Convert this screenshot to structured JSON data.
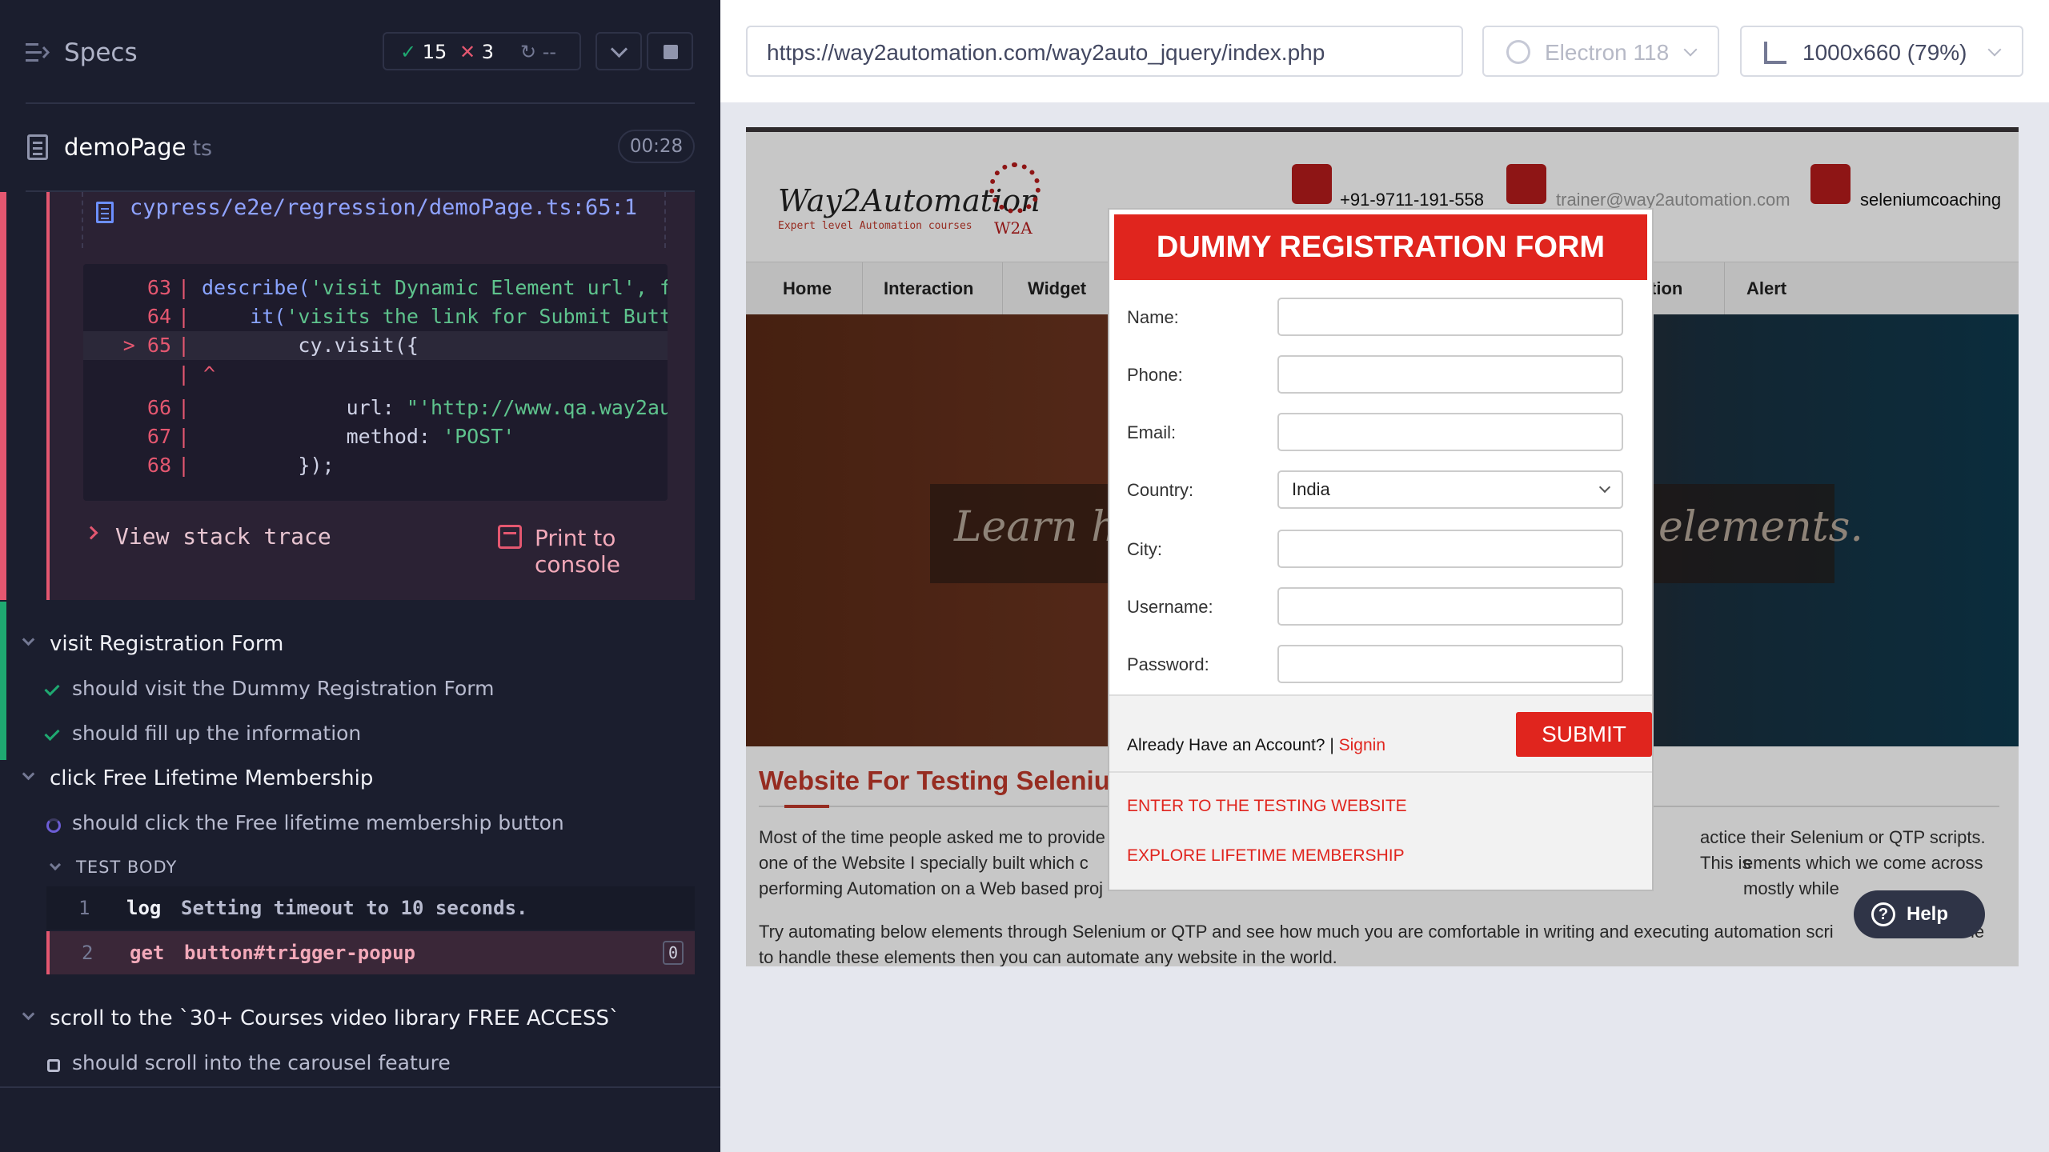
{
  "reporter": {
    "title": "Specs",
    "stats": {
      "passed": "15",
      "failed": "3",
      "pending": "--"
    },
    "file": {
      "name": "demoPage",
      "ext": "ts",
      "duration": "00:28"
    },
    "error": {
      "path": "cypress/e2e/regression/demoPage.ts:65:1",
      "code": [
        {
          "num": "63",
          "marker": "",
          "text_a": "describe(",
          "text_b": "'visit Dynamic Element url', f"
        },
        {
          "num": "64",
          "marker": "",
          "text_a": "    it(",
          "text_b": "'visits the link for Submit Butt"
        },
        {
          "num": "65",
          "marker": "> ",
          "text_a": "        cy.visit({",
          "text_b": ""
        },
        {
          "num": "",
          "marker": "",
          "text_a": "^",
          "text_b": ""
        },
        {
          "num": "66",
          "marker": "",
          "text_a": "            url: ",
          "text_b": "\"'http://www.qa.way2au"
        },
        {
          "num": "67",
          "marker": "",
          "text_a": "            method: ",
          "text_b": "'POST'"
        },
        {
          "num": "68",
          "marker": "",
          "text_a": "        });",
          "text_b": ""
        }
      ],
      "stack_label": "View stack trace",
      "print_label": "Print to console"
    },
    "suites": [
      {
        "title": "visit Registration Form",
        "tests": [
          "should visit the Dummy Registration Form",
          "should fill up the information"
        ]
      },
      {
        "title": "click Free Lifetime Membership",
        "tests": [
          "should click the Free lifetime membership button"
        ]
      },
      {
        "title": "scroll to the `30+ Courses video library FREE ACCESS`",
        "tests": [
          "should scroll into the carousel feature"
        ]
      }
    ],
    "test_body_label": "TEST BODY",
    "commands": [
      {
        "num": "1",
        "name": "log",
        "message": "Setting timeout to 10 seconds."
      },
      {
        "num": "2",
        "name": "get",
        "message": "button#trigger-popup",
        "badge": "0"
      }
    ]
  },
  "browser": {
    "url": "https://way2automation.com/way2auto_jquery/index.php",
    "engine": "Electron 118",
    "viewport": "1000x660",
    "zoom": "(79%)"
  },
  "site": {
    "logo_text": "Way2Automation",
    "logo_sub": "Expert level Automation courses",
    "logo_mark": "W2A",
    "phone": "+91-9711-191-558",
    "email": "trainer@way2automation.com",
    "skype": "seleniumcoaching",
    "nav": [
      "Home",
      "Interaction",
      "Widget",
      "tion",
      "Alert"
    ],
    "hero_left": "Learn ho",
    "hero_right": "elements.",
    "section_title": "Website For Testing Selenium",
    "para1_left": "Most of the time people asked me to provide",
    "para1_right": "actice their Selenium or QTP scripts. This is",
    "para1_line2_left": "one of the Website I specially built which c",
    "para1_line2_right": "ements which we come across mostly while",
    "para1_line3": "performing Automation on a Web based proj",
    "para2_line1": "Try automating below elements through Selenium or QTP and see how much you are comfortable in writing and executing automation scri",
    "para2_line1_right": "le",
    "para2_line2": "to handle these elements then you can automate any website in the world.",
    "help": "Help"
  },
  "modal": {
    "title": "DUMMY REGISTRATION FORM",
    "fields": [
      {
        "label": "Name:",
        "value": ""
      },
      {
        "label": "Phone:",
        "value": ""
      },
      {
        "label": "Email:",
        "value": ""
      },
      {
        "label": "Country:",
        "value": "India"
      },
      {
        "label": "City:",
        "value": ""
      },
      {
        "label": "Username:",
        "value": ""
      },
      {
        "label": "Password:",
        "value": ""
      }
    ],
    "already": "Already Have an Account? | ",
    "signin": "Signin",
    "submit": "SUBMIT",
    "link1": "ENTER TO THE TESTING WEBSITE",
    "link2": "EXPLORE LIFETIME MEMBERSHIP"
  },
  "colors": {
    "pass": "#1fa971",
    "fail": "#e45770",
    "accent": "#e0251e"
  }
}
